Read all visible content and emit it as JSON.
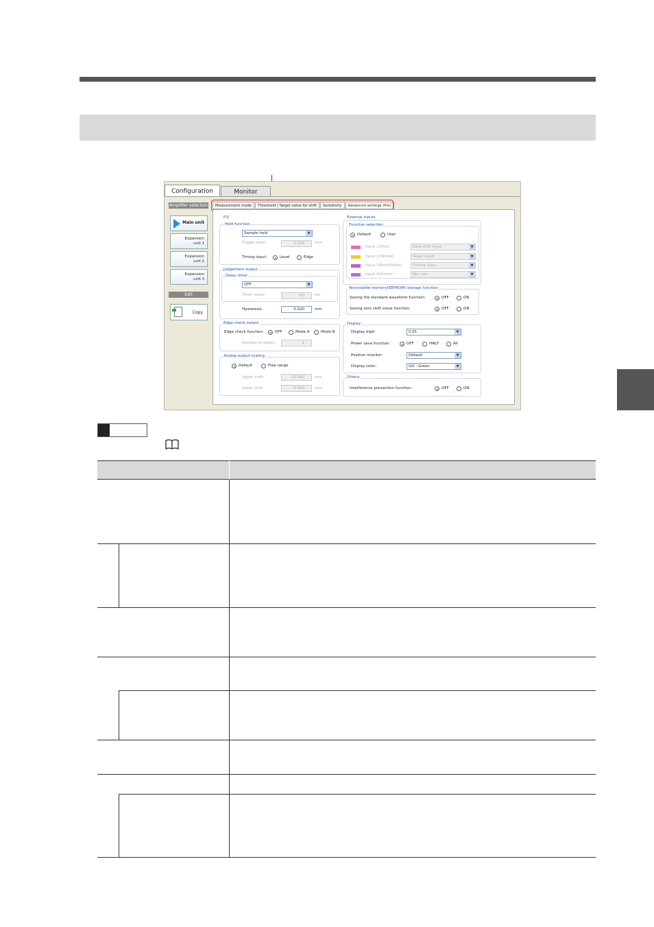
{
  "screenshot": {
    "main_tabs": [
      "Configuration",
      "Monitor"
    ],
    "amplifier_selection": {
      "heading": "Amplifier selection",
      "units": [
        "Main unit",
        "Expansion unit 1",
        "Expansion unit 2",
        "Expansion unit 3"
      ]
    },
    "edit": {
      "heading": "Edit",
      "copy_label": "Copy"
    },
    "sub_tabs": [
      "Measurement mode",
      "Threshold / Target value for shift",
      "Sensitivity",
      "Advanced settings (Pro)"
    ],
    "pv": {
      "title": "P.V.",
      "hold_function": {
        "title": "Hold function",
        "mode": "Sample hold",
        "trigger_level_label": "Trigger level:",
        "trigger_level_value": "0.100",
        "trigger_level_unit": "mm",
        "timing_input_label": "Timing input:",
        "timing_options": [
          "Level",
          "Edge"
        ],
        "timing_selected": "Level"
      },
      "judgement_output": {
        "title": "Judgement output",
        "delay_timer_title": "Delay timer",
        "delay_timer_mode": "OFF",
        "timer_value_label": "Timer value:",
        "timer_value": "60",
        "timer_unit": "ms",
        "hysteresis_label": "Hysteresis:",
        "hysteresis_value": "0.020",
        "hysteresis_unit": "mm"
      },
      "edge_check_output": {
        "title": "Edge check output",
        "function_label": "Edge check function:",
        "options": [
          "OFF",
          "Mode A",
          "Mode B"
        ],
        "selected": "OFF",
        "edges_label": "Number of edges:",
        "edges_value": "1"
      },
      "analog_output_scaling": {
        "title": "Analog output scaling",
        "options": [
          "Default",
          "Free range"
        ],
        "selected": "Default",
        "upper_label": "Upper limit:",
        "upper_value": "10.000",
        "upper_unit": "mm",
        "lower_label": "Lower limit:",
        "lower_value": "0.000",
        "lower_unit": "mm"
      }
    },
    "external_inputs": {
      "title": "External inputs",
      "function_selection_title": "Function selection",
      "options": [
        "Default",
        "User"
      ],
      "selected": "Default",
      "inputs": [
        {
          "label": "Input 1(Pink):",
          "value": "Zero shift input",
          "color": "#e070b0"
        },
        {
          "label": "Input 2(Yellow):",
          "value": "Reset input",
          "color": "#e8d020"
        },
        {
          "label": "Input 3(Pink/Violet):",
          "value": "Timing input",
          "color": "#c060c0"
        },
        {
          "label": "Input 4(Violet):",
          "value": "Not use",
          "color": "#b070d0"
        }
      ]
    },
    "nonvolatile": {
      "title": "Nonvolatile memory(EEPROM) storage function",
      "rows": [
        {
          "label": "Saving the standard waveform function:",
          "options": [
            "OFF",
            "ON"
          ],
          "selected": "OFF"
        },
        {
          "label": "Saving zero shift value function:",
          "options": [
            "OFF",
            "ON"
          ],
          "selected": "OFF"
        }
      ]
    },
    "display": {
      "title": "Display",
      "digit_label": "Display digit:",
      "digit_value": "0.01",
      "power_save_label": "Power save function:",
      "power_save_options": [
        "OFF",
        "HALF",
        "All"
      ],
      "power_save_selected": "OFF",
      "position_label": "Position monitor:",
      "position_value": "Default",
      "color_label": "Display color:",
      "color_value": "GO : Green"
    },
    "others": {
      "title": "Others",
      "label": "Interference prevention function:",
      "options": [
        "OFF",
        "ON"
      ],
      "selected": "OFF"
    }
  },
  "colors": {
    "header_rule": "#555555",
    "section_band": "#d9d9d9",
    "highlight": "#dd2222",
    "group_title": "#1a4fb8"
  }
}
